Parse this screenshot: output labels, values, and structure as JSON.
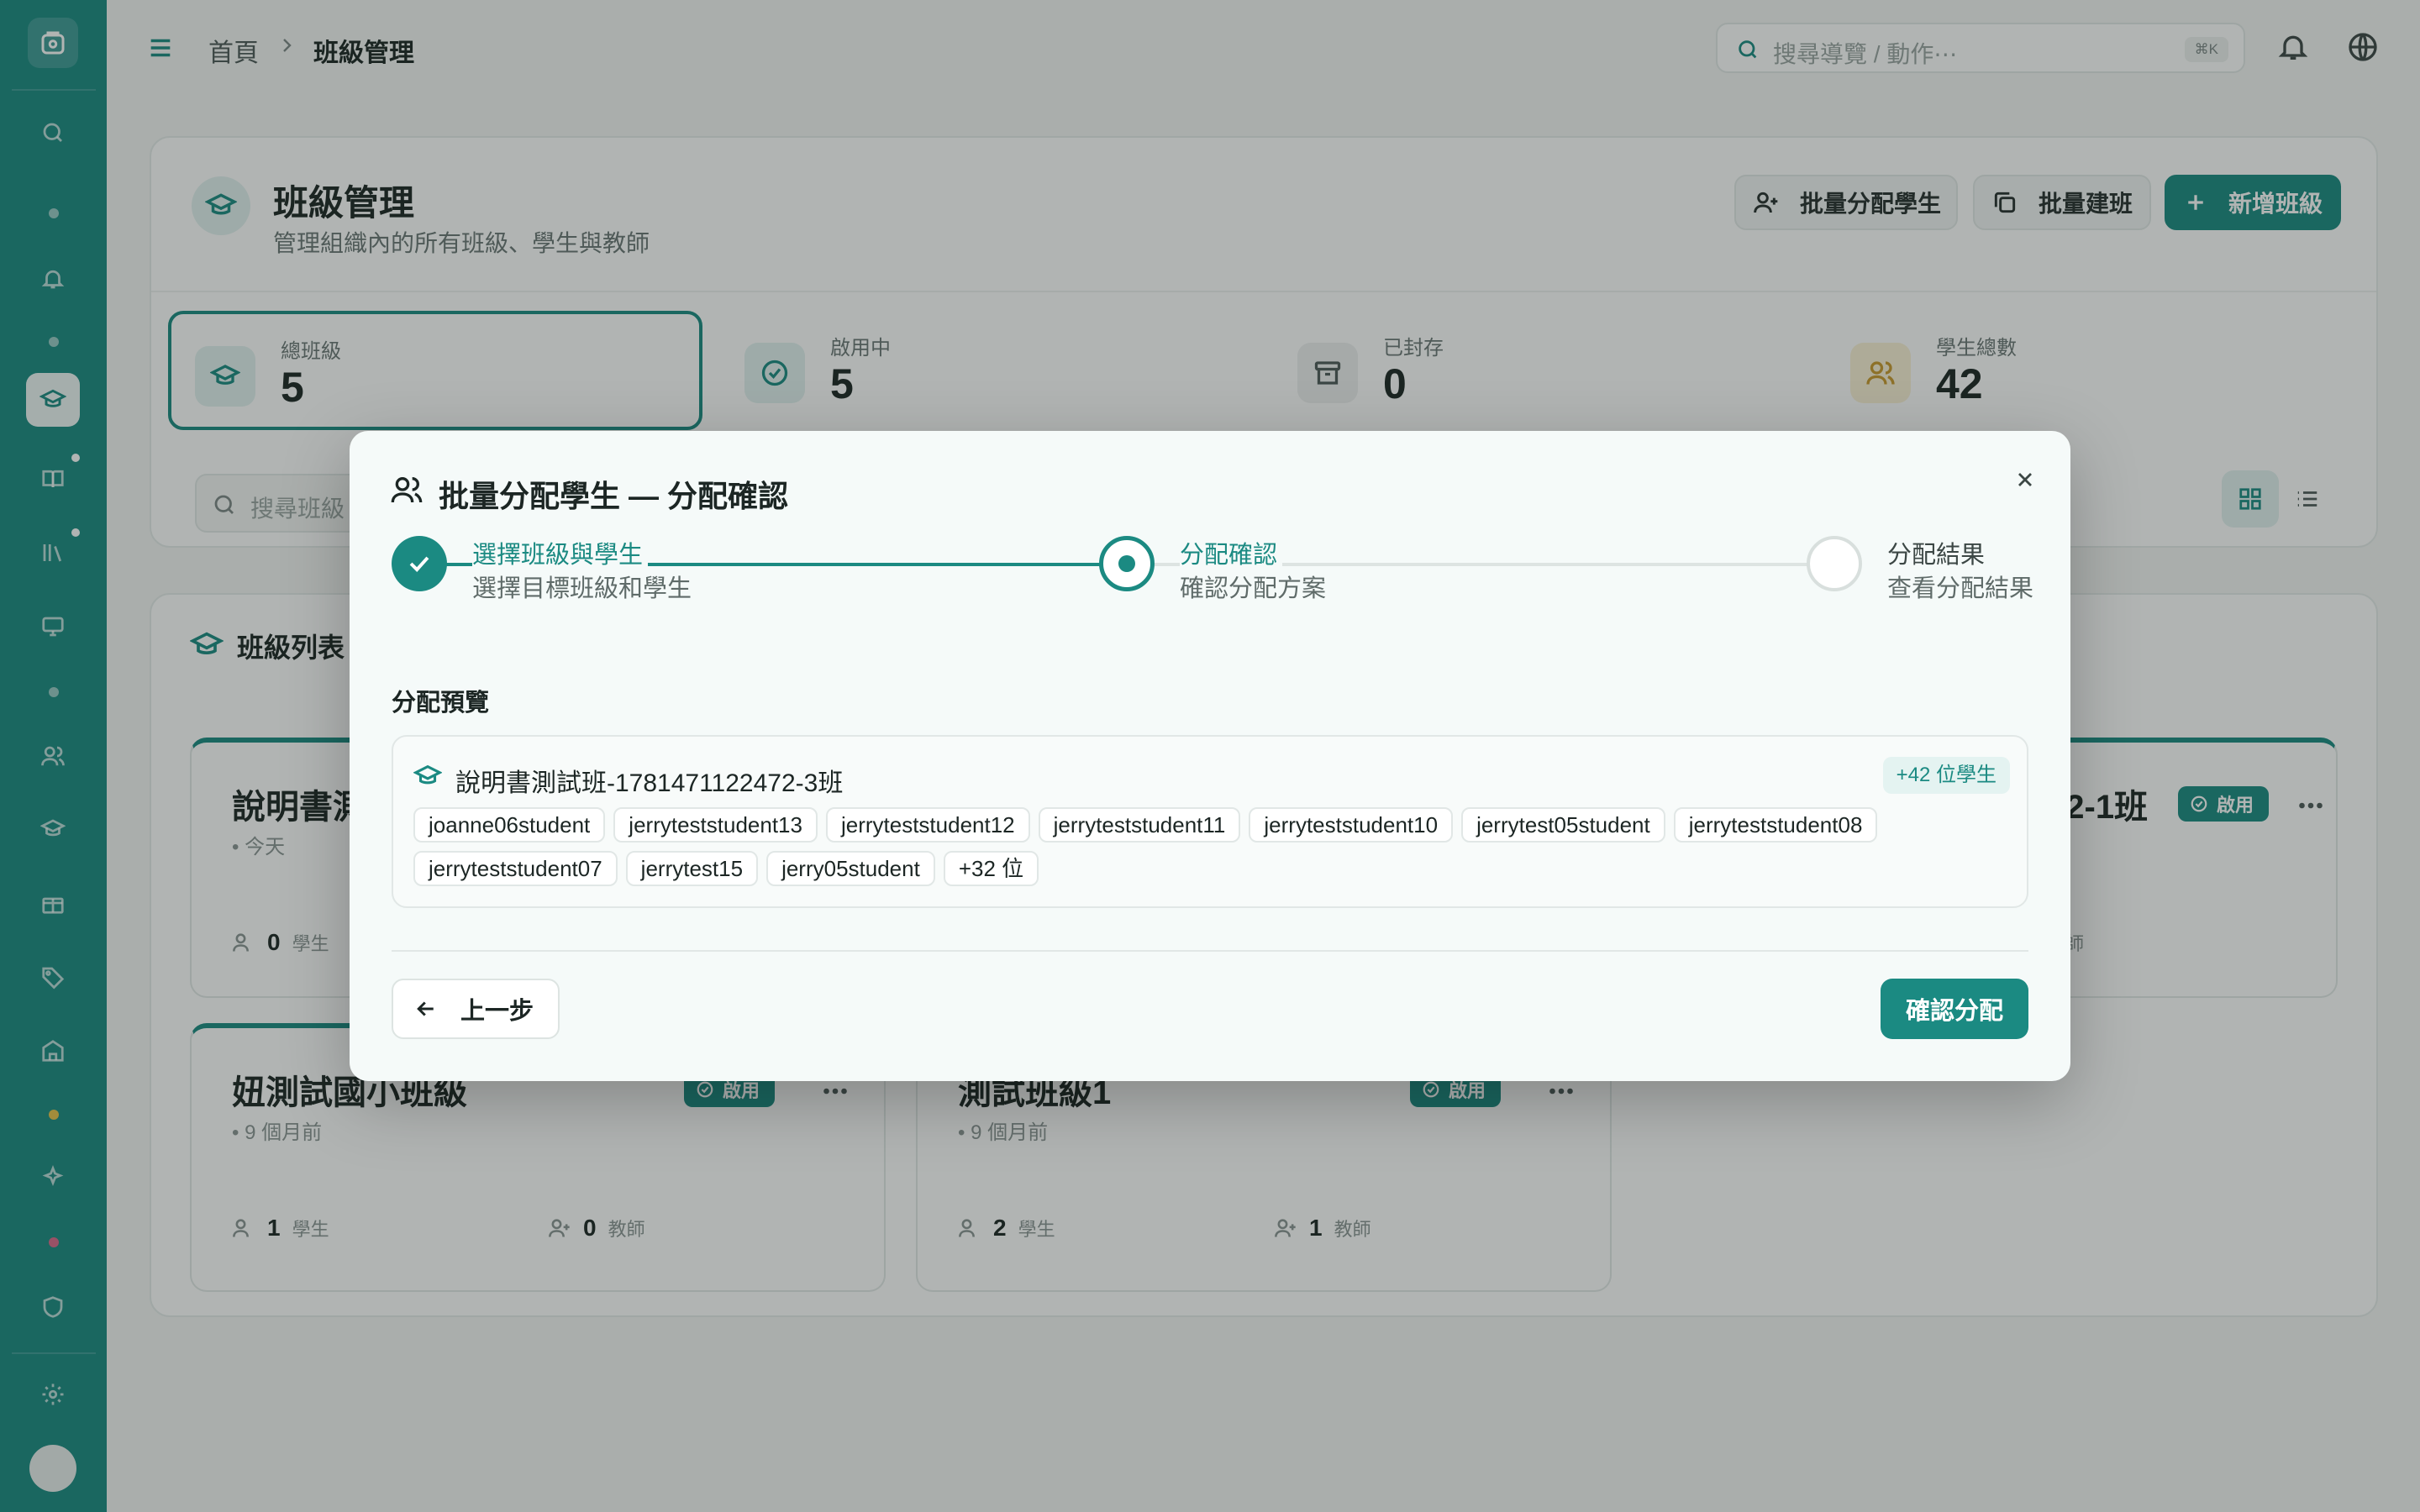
{
  "colors": {
    "accent": "#1b8a82",
    "overlay": "rgba(26,34,32,0.34)"
  },
  "topbar": {
    "breadcrumb": [
      "首頁",
      "班級管理"
    ],
    "search_placeholder": "搜尋導覽 / 動作⋯",
    "search_shortcut": "⌘K"
  },
  "page": {
    "title": "班級管理",
    "subtitle": "管理組織內的所有班級、學生與教師",
    "buttons": {
      "batch_assign": "批量分配學生",
      "batch_create": "批量建班",
      "add_class": "新增班級"
    }
  },
  "stats": [
    {
      "label": "總班級",
      "value": "5",
      "icon": "graduation-cap-icon"
    },
    {
      "label": "啟用中",
      "value": "5",
      "icon": "check-circle-icon"
    },
    {
      "label": "已封存",
      "value": "0",
      "icon": "archive-icon"
    },
    {
      "label": "學生總數",
      "value": "42",
      "icon": "users-icon"
    }
  ],
  "filter": {
    "search_placeholder": "搜尋班級"
  },
  "class_list": {
    "title": "班級列表",
    "cards": [
      {
        "name": "說明書測",
        "time": "• 今天",
        "students": "0",
        "student_label": "學生"
      },
      {
        "name": "妞測試國小班級",
        "time": "• 9 個月前",
        "badge": "啟用",
        "students": "1",
        "student_label": "學生",
        "teachers": "0",
        "teacher_label": "教師"
      },
      {
        "name": "測試班級1",
        "time": "• 9 個月前",
        "badge": "啟用",
        "students": "2",
        "student_label": "學生",
        "teachers": "1",
        "teacher_label": "教師"
      },
      {
        "name": "72-1班",
        "badge": "啟用",
        "teacher_label": "教師"
      }
    ]
  },
  "modal": {
    "title": "批量分配學生 — 分配確認",
    "steps": [
      {
        "title": "選擇班級與學生",
        "desc": "選擇目標班級和學生",
        "state": "done"
      },
      {
        "title": "分配確認",
        "desc": "確認分配方案",
        "state": "current"
      },
      {
        "title": "分配結果",
        "desc": "查看分配結果",
        "state": "todo"
      }
    ],
    "preview_label": "分配預覽",
    "preview": {
      "class_name": "說明書測試班-1781471122472-3班",
      "count_badge": "+42 位學生",
      "students": [
        "joanne06student",
        "jerryteststudent13",
        "jerryteststudent12",
        "jerryteststudent11",
        "jerryteststudent10",
        "jerrytest05student",
        "jerryteststudent08",
        "jerryteststudent07",
        "jerrytest15",
        "jerry05student",
        "+32 位"
      ]
    },
    "back_label": "上一步",
    "confirm_label": "確認分配"
  }
}
